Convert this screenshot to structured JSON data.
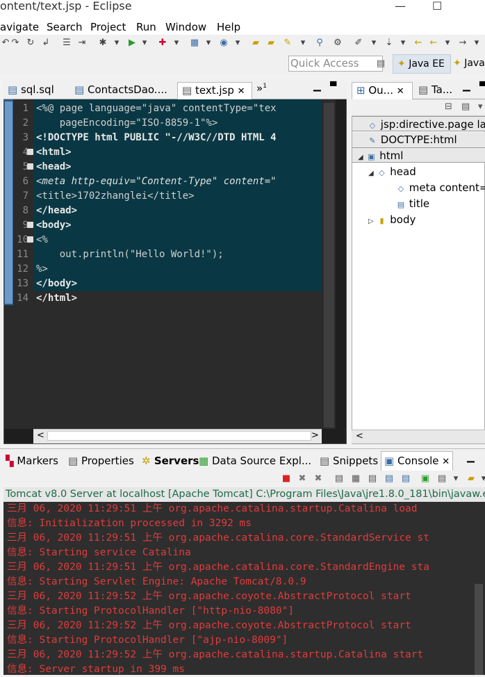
{
  "window": {
    "title": "ontent/text.jsp - Eclipse",
    "min_icon": "—",
    "max_icon": "☐"
  },
  "menu": [
    "avigate",
    "Search",
    "Project",
    "Run",
    "Window",
    "Help"
  ],
  "quick_access": "Quick Access",
  "perspectives": {
    "active": "Java EE",
    "other": "Java"
  },
  "editor": {
    "tabs": [
      {
        "label": "sql.sql"
      },
      {
        "label": "ContactsDao...."
      },
      {
        "label": "text.jsp",
        "close": "✕"
      }
    ],
    "more": "»",
    "more_count": "1",
    "line_numbers": [
      "1",
      "2",
      "3",
      "4",
      "5",
      "6",
      "7",
      "8",
      "9",
      "10",
      "11",
      "12",
      "13",
      "14"
    ],
    "lines": [
      "<%@ page language=\"java\" contentType=\"tex",
      "    pageEncoding=\"ISO-8859-1\"%>",
      "<!DOCTYPE html PUBLIC \"-//W3C//DTD HTML 4",
      "<html>",
      "<head>",
      "<meta http-equiv=\"Content-Type\" content=\"",
      "<title>1702zhanglei</title>",
      "</head>",
      "<body>",
      "<%",
      "    out.println(\"Hello World!\");",
      "%>",
      "</body>",
      "</html>"
    ]
  },
  "outline": {
    "tabs": [
      {
        "label": "Ou...",
        "close": "✕"
      },
      {
        "label": "Ta..."
      }
    ],
    "items": [
      {
        "label": "jsp:directive.page la",
        "icon": "◇"
      },
      {
        "label": "DOCTYPE:html",
        "icon": "✎"
      },
      {
        "label": "html",
        "icon": "▣"
      },
      {
        "label": "head",
        "icon": "◇"
      },
      {
        "label": "meta content=",
        "icon": "◇"
      },
      {
        "label": "title",
        "icon": "▤"
      },
      {
        "label": "body",
        "icon": "▮"
      }
    ]
  },
  "bottom": {
    "tabs": [
      {
        "label": "Markers"
      },
      {
        "label": "Properties"
      },
      {
        "label": "Servers"
      },
      {
        "label": "Data Source Expl..."
      },
      {
        "label": "Snippets"
      },
      {
        "label": "Console",
        "close": "✕"
      }
    ],
    "console_title": "Tomcat v8.0 Server at localhost [Apache Tomcat] C:\\Program Files\\Java\\jre1.8.0_181\\bin\\javaw.e",
    "console_lines": [
      "三月 06, 2020 11:29:51 上午 org.apache.catalina.startup.Catalina load",
      "信息: Initialization processed in 3292 ms",
      "三月 06, 2020 11:29:51 上午 org.apache.catalina.core.StandardService st",
      "信息: Starting service Catalina",
      "三月 06, 2020 11:29:51 上午 org.apache.catalina.core.StandardEngine sta",
      "信息: Starting Servlet Engine: Apache Tomcat/8.0.9",
      "三月 06, 2020 11:29:52 上午 org.apache.coyote.AbstractProtocol start",
      "信息: Starting ProtocolHandler [\"http-nio-8080\"]",
      "三月 06, 2020 11:29:52 上午 org.apache.coyote.AbstractProtocol start",
      "信息: Starting ProtocolHandler [\"ajp-nio-8009\"]",
      "三月 06, 2020 11:29:52 上午 org.apache.catalina.startup.Catalina start",
      "信息: Server startup in 399 ms"
    ]
  },
  "colors": {
    "editor_bg": "#2b2b2b",
    "selection": "#093844",
    "console_bg": "#2e2e2e",
    "console_text": "#e23b3b",
    "console_title": "#1a6b47"
  }
}
